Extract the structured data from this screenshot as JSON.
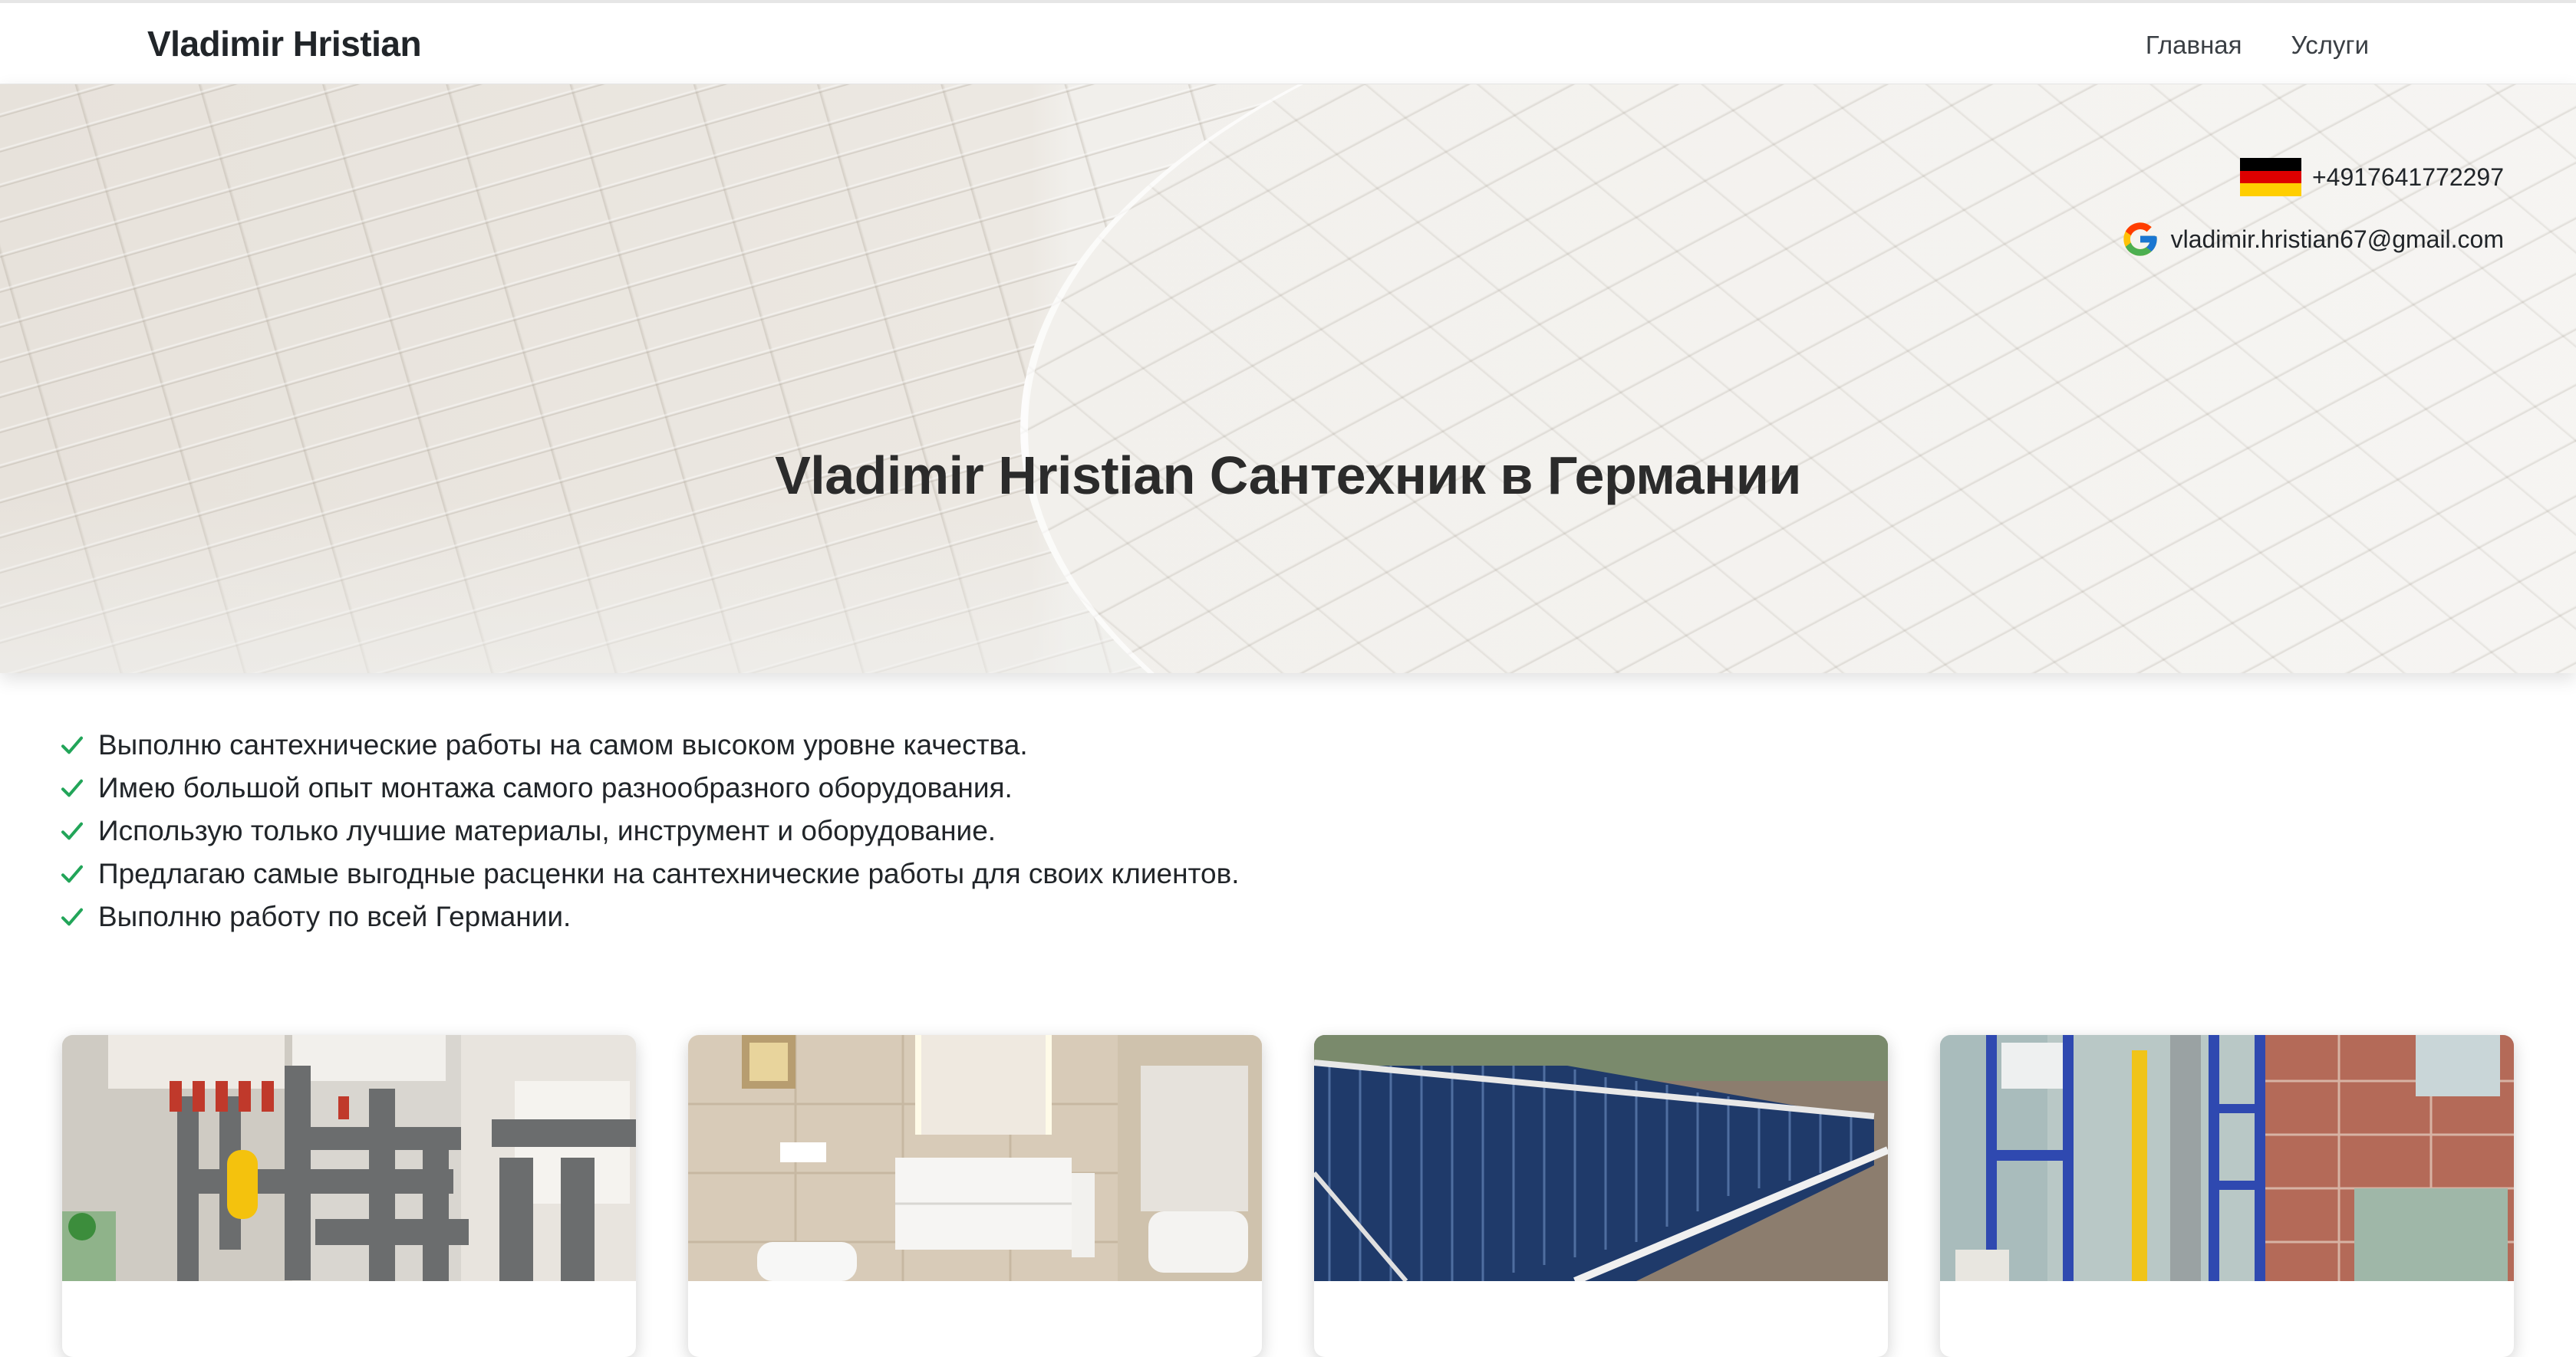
{
  "nav": {
    "brand": "Vladimir Hristian",
    "links": [
      "Главная",
      "Услуги"
    ]
  },
  "hero": {
    "phone": "+4917641772297",
    "email": "vladimir.hristian67@gmail.com",
    "title": "Vladimir Hristian Сантехник в Германии"
  },
  "features": [
    "Выполню сантехнические работы на самом высоком уровне качества.",
    "Имею большой опыт монтажа самого разнообразного оборудования.",
    "Использую только лучшие материалы, инструмент и оборудование.",
    "Предлагаю самые выгодные расценки на сантехнические работы для своих клиентов.",
    "Выполню работу по всей Германии."
  ],
  "icons": {
    "flag": "germany-flag-icon",
    "email": "google-icon",
    "check": "check-icon"
  },
  "colors": {
    "check": "#22a559",
    "flag_black": "#000000",
    "flag_red": "#dd0000",
    "flag_gold": "#ffce00"
  }
}
